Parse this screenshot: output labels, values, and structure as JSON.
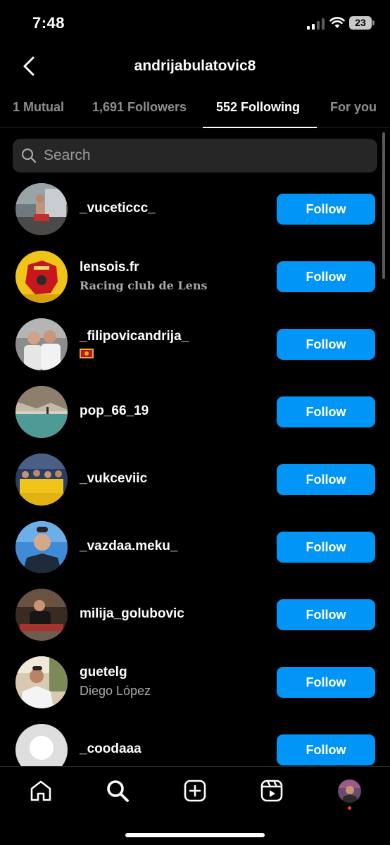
{
  "status_bar": {
    "time": "7:48",
    "battery": "23"
  },
  "header": {
    "username": "andrijabulatovic8"
  },
  "tabs": [
    {
      "label": "1 Mutual"
    },
    {
      "label": "1,691 Followers"
    },
    {
      "label": "552 Following",
      "active": true
    },
    {
      "label": "For you"
    }
  ],
  "search": {
    "placeholder": "Search",
    "value": ""
  },
  "following": [
    {
      "username": "_vuceticcc_",
      "subtitle": "",
      "button": "Follow"
    },
    {
      "username": "lensois.fr",
      "subtitle": "Racing club de Lens",
      "button": "Follow"
    },
    {
      "username": "_filipovicandrija_",
      "subtitle": "",
      "subtitle_icon": "montenegro-flag-icon",
      "button": "Follow"
    },
    {
      "username": "pop_66_19",
      "subtitle": "",
      "button": "Follow"
    },
    {
      "username": "_vukceviic",
      "subtitle": "",
      "button": "Follow"
    },
    {
      "username": "_vazdaa.meku_",
      "subtitle": "",
      "button": "Follow"
    },
    {
      "username": "milija_golubovic",
      "subtitle": "",
      "button": "Follow"
    },
    {
      "username": "guetelg",
      "subtitle": "Diego López",
      "button": "Follow"
    },
    {
      "username": "_coodaaa",
      "subtitle": "",
      "button": "Follow"
    }
  ],
  "bottom_nav": [
    "home-icon",
    "search-icon",
    "create-icon",
    "reels-icon",
    "profile-avatar"
  ],
  "colors": {
    "accent": "#0095f6",
    "background": "#000000",
    "search_bg": "#262626",
    "secondary_text": "#a8a8a8"
  }
}
